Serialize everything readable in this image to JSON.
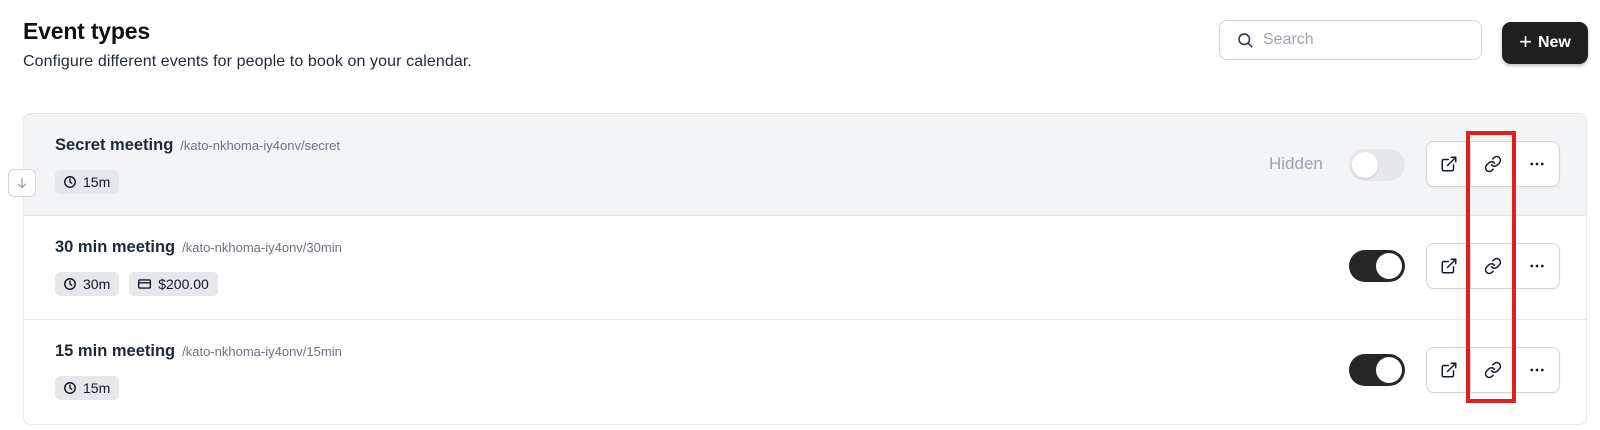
{
  "header": {
    "title": "Event types",
    "subtitle": "Configure different events for people to book on your calendar."
  },
  "search": {
    "placeholder": "Search",
    "value": "",
    "icon": "search-icon"
  },
  "new_button": {
    "label": "New",
    "icon": "plus-icon"
  },
  "events": [
    {
      "name": "Secret meeting",
      "slug": "/kato-nkhoma-iy4onv/secret",
      "duration": "15m",
      "price": null,
      "hidden_label": "Hidden",
      "enabled": false
    },
    {
      "name": "30 min meeting",
      "slug": "/kato-nkhoma-iy4onv/30min",
      "duration": "30m",
      "price": "$200.00",
      "enabled": true
    },
    {
      "name": "15 min meeting",
      "slug": "/kato-nkhoma-iy4onv/15min",
      "duration": "15m",
      "price": null,
      "enabled": true
    }
  ],
  "row_actions": [
    "external-link-icon",
    "link-icon",
    "more-horizontal-icon"
  ],
  "colors": {
    "primary": "#1f1f1f",
    "highlight": "#e0201c",
    "badge": "#e5e7eb",
    "row_hidden_bg": "#f3f4f6"
  }
}
